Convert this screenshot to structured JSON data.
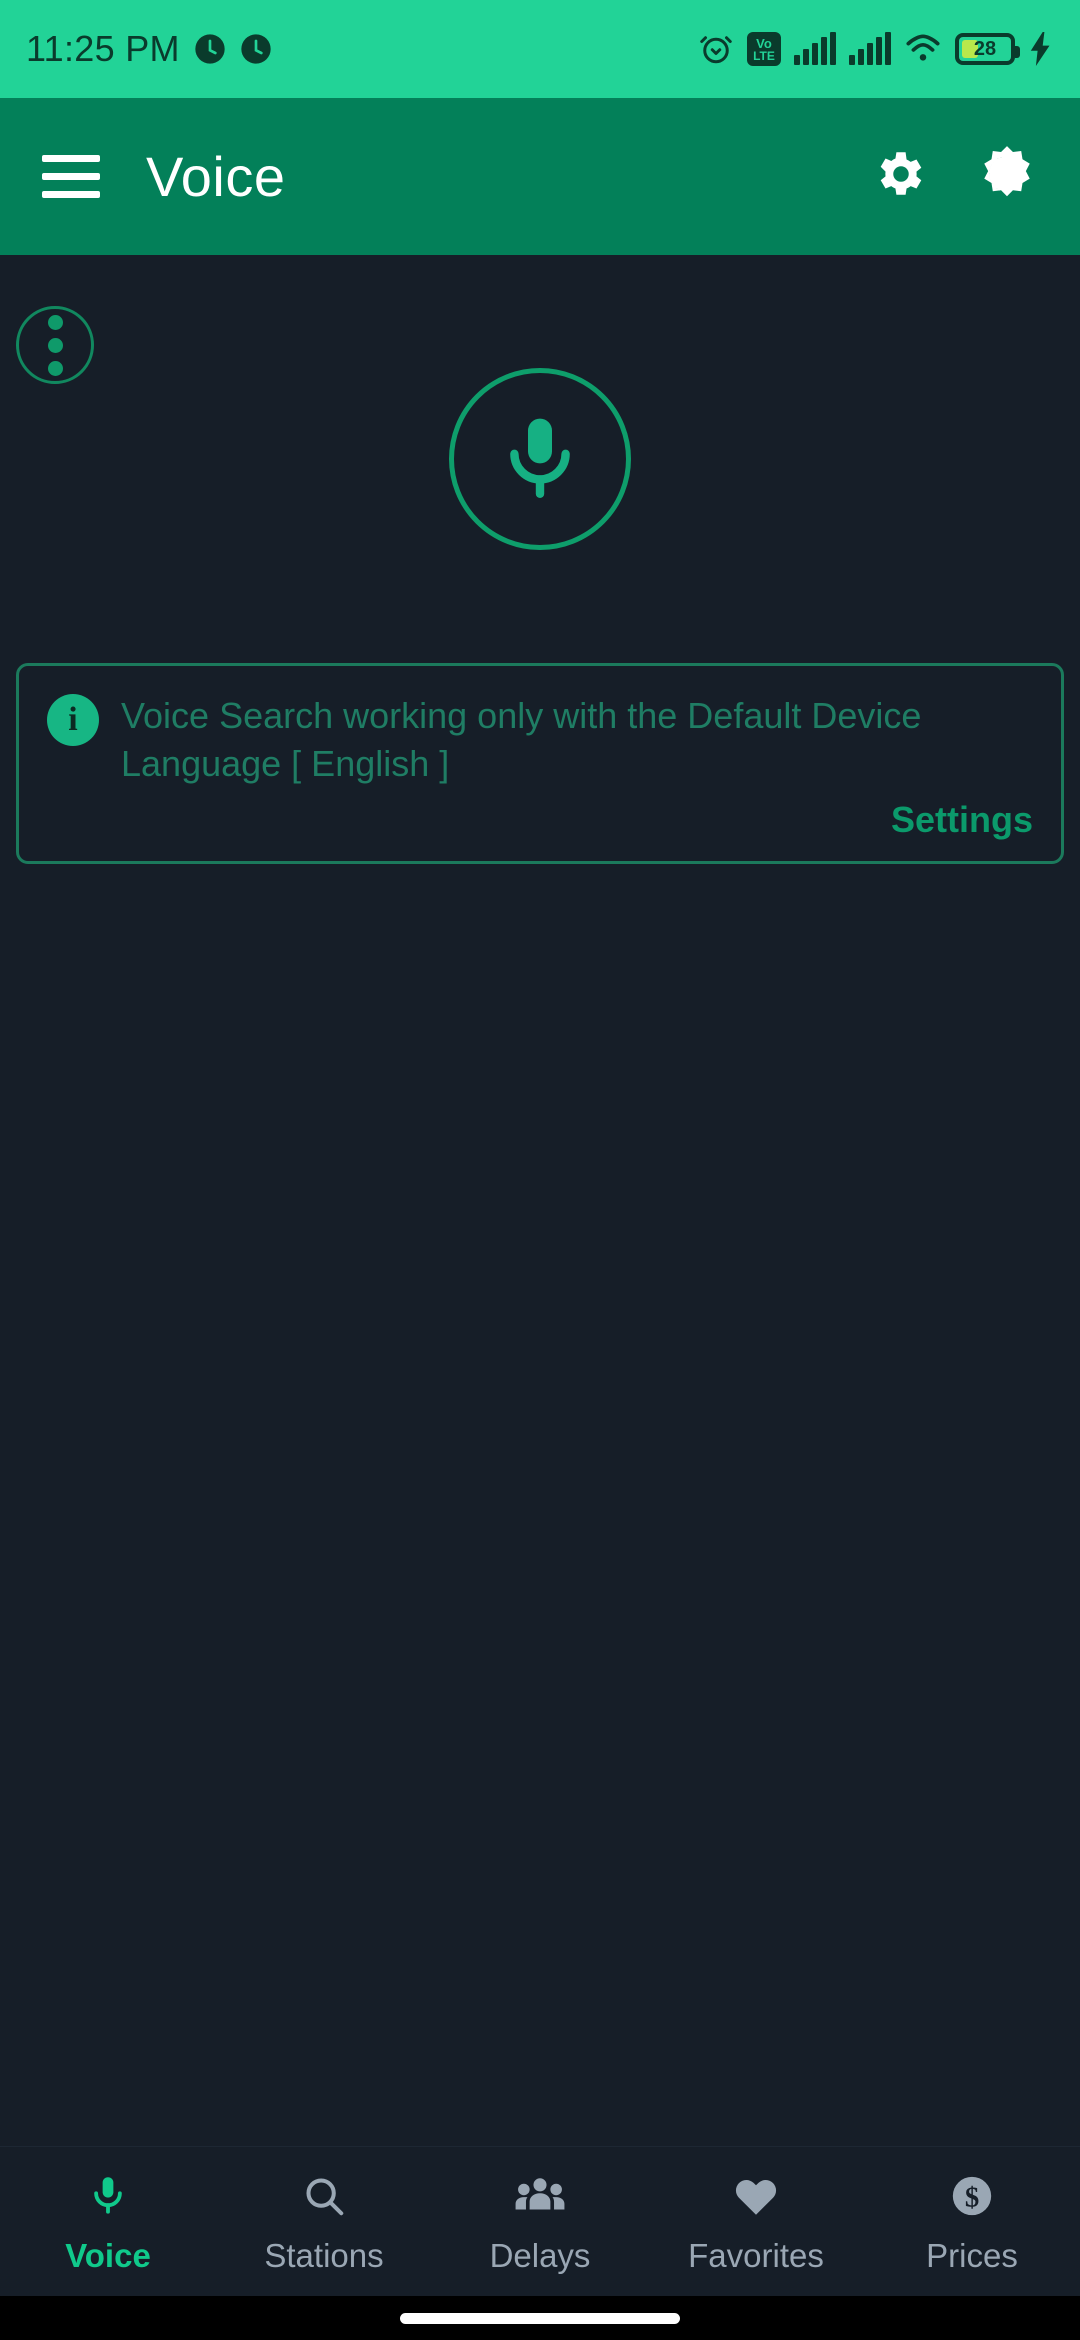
{
  "status_bar": {
    "time": "11:25 PM",
    "background_color": "#22d397",
    "icon_color": "#0a3b2c",
    "left_icons": [
      "clock-badge-icon",
      "clock-badge-icon"
    ],
    "right_icons": [
      "alarm-icon",
      "volte-icon",
      "signal-sim1-icon",
      "signal-sim2-icon",
      "wifi-icon",
      "battery-icon",
      "charging-bolt-icon"
    ],
    "volte_top": "Vo",
    "volte_bottom": "LTE",
    "battery_level": "28",
    "battery_charging": true
  },
  "app_bar": {
    "title": "Voice",
    "background_color": "#038059",
    "menu_icon": "hamburger-menu-icon",
    "actions": [
      {
        "icon": "gear-icon",
        "name": "settings-button"
      },
      {
        "icon": "dark-mode-toggle-icon",
        "name": "theme-toggle-button"
      }
    ]
  },
  "main": {
    "background_color": "#161e28",
    "overflow_menu_icon": "three-dots-vertical-icon",
    "mic_button": {
      "icon": "microphone-icon",
      "accent_color": "#0e9e6b"
    },
    "info_card": {
      "icon": "info-icon",
      "message": "Voice Search working only with the Default Device Language [ English ]",
      "link_label": "Settings",
      "border_color": "#1b7a5c",
      "text_color": "#1f7d64",
      "link_color": "#0b9a6b"
    }
  },
  "bottom_nav": {
    "active_color": "#10c98b",
    "inactive_color": "#9aa7b4",
    "items": [
      {
        "label": "Voice",
        "icon": "microphone-icon",
        "active": true
      },
      {
        "label": "Stations",
        "icon": "search-icon",
        "active": false
      },
      {
        "label": "Delays",
        "icon": "people-group-icon",
        "active": false
      },
      {
        "label": "Favorites",
        "icon": "heart-icon",
        "active": false
      },
      {
        "label": "Prices",
        "icon": "dollar-coin-icon",
        "active": false
      }
    ]
  },
  "gesture_bar": {
    "indicator": "home-gesture-pill"
  }
}
